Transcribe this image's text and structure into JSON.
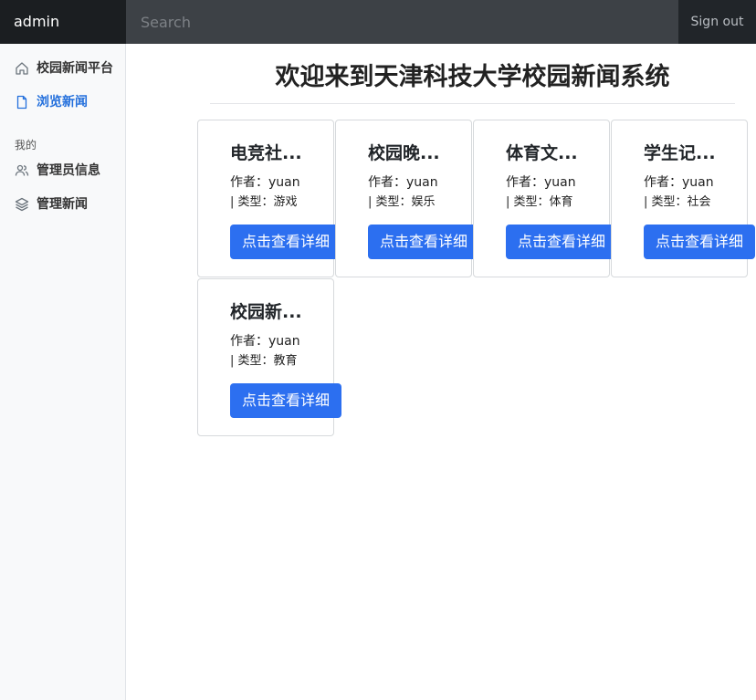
{
  "navbar": {
    "brand": "admin",
    "search_placeholder": "Search",
    "signout_label": "Sign out"
  },
  "sidebar": {
    "items": [
      {
        "label": "校园新闻平台",
        "icon": "home-icon",
        "active": false
      },
      {
        "label": "浏览新闻",
        "icon": "file-icon",
        "active": true
      }
    ],
    "section_heading": "我的",
    "section_items": [
      {
        "label": "管理员信息",
        "icon": "users-icon"
      },
      {
        "label": "管理新闻",
        "icon": "layers-icon"
      }
    ]
  },
  "main": {
    "title": "欢迎来到天津科技大学校园新闻系统",
    "cards": [
      {
        "title": "电竞社...",
        "author": "作者：yuan",
        "type": "| 类型：游戏",
        "button": "点击查看详细"
      },
      {
        "title": "校园晚...",
        "author": "作者：yuan",
        "type": "| 类型：娱乐",
        "button": "点击查看详细"
      },
      {
        "title": "体育文...",
        "author": "作者：yuan",
        "type": "| 类型：体育",
        "button": "点击查看详细"
      },
      {
        "title": "学生记...",
        "author": "作者：yuan",
        "type": "| 类型：社会",
        "button": "点击查看详细"
      },
      {
        "title": "校园新...",
        "author": "作者：yuan",
        "type": "| 类型：教育",
        "button": "点击查看详细"
      }
    ]
  },
  "colors": {
    "navbar_bg": "#212529",
    "accent": "#2c6ff0",
    "active_link": "#2470dc"
  }
}
